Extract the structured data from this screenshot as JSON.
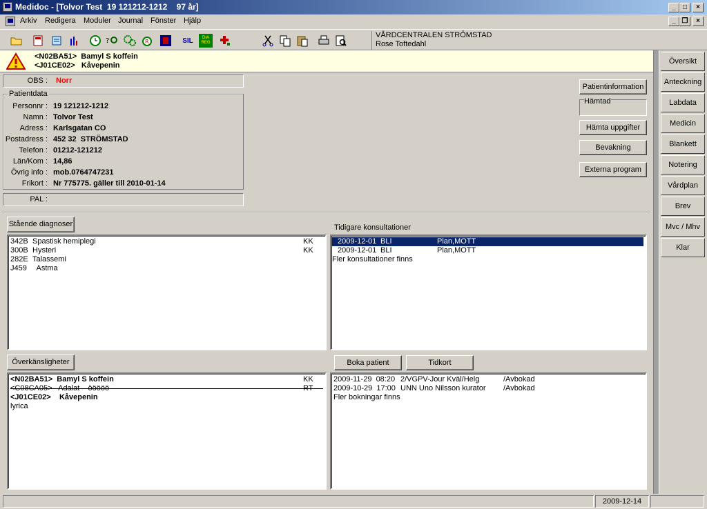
{
  "window": {
    "title": "Medidoc - [Tolvor Test  19 121212-1212    97 år]",
    "controls": {
      "minimize": "_",
      "maximize": "□",
      "close": "×",
      "restore": "❐"
    }
  },
  "menu": [
    {
      "label": "Arkiv"
    },
    {
      "label": "Redigera"
    },
    {
      "label": "Moduler"
    },
    {
      "label": "Journal"
    },
    {
      "label": "Fönster"
    },
    {
      "label": "Hjälp"
    }
  ],
  "toolbar": {
    "icons": [
      "open-folder-icon",
      "patient-card-icon",
      "notes-icon",
      "chart-icon",
      "clock-icon",
      "search-patient-icon",
      "gears-icon",
      "prescription-icon",
      "image-icon",
      "sil-icon",
      "diareg-icon",
      "medical-cross-icon",
      "scissors-icon",
      "copy-icon",
      "paste-icon",
      "print-icon",
      "print-preview-icon"
    ],
    "sil_text": "SIL",
    "diareg_text": "DIA\nREG",
    "clinic_name": "VÅRDCENTRALEN STRÖMSTAD",
    "user_name": "Rose Toftedahl"
  },
  "warning": {
    "line1": "<N02BA51>  Bamyl S koffein",
    "line2": "<J01CE02>   Kåvepenin"
  },
  "obs": {
    "label": "OBS :",
    "value": "Norr",
    "color": "#ff0000"
  },
  "patientdata": {
    "title": "Patientdata",
    "fields": [
      {
        "label": "Personnr :",
        "value": "19 121212-1212"
      },
      {
        "label": "Namn :",
        "value": "Tolvor Test"
      },
      {
        "label": "Adress :",
        "value": "Karlsgatan CO"
      },
      {
        "label": "Postadress :",
        "value": "452 32  STRÖMSTAD"
      },
      {
        "label": "Telefon :",
        "value": "01212-121212"
      },
      {
        "label": "Län/Kom :",
        "value": "14,86"
      },
      {
        "label": "Övrig info :",
        "value": "mob.0764747231"
      },
      {
        "label": "Frikort :",
        "value": "Nr 775775. gäller till 2010-01-14"
      }
    ]
  },
  "pal": {
    "label": "PAL :",
    "value": ""
  },
  "right_buttons": {
    "patientinformation": "Patientinformation",
    "hamtad": "Hämtad",
    "hamta": "Hämta uppgifter",
    "bevakning": "Bevakning",
    "externa": "Externa program"
  },
  "diagnoses": {
    "button": "Stående diagnoser",
    "rows": [
      {
        "code": "342B",
        "text": "Spastisk hemiplegi",
        "flag": "KK"
      },
      {
        "code": "300B",
        "text": "Hysteri",
        "flag": "KK"
      },
      {
        "code": "282E",
        "text": "Talassemi",
        "flag": ""
      },
      {
        "code": "J459",
        "text": "  Astma",
        "flag": ""
      }
    ]
  },
  "consultations": {
    "label": "Tidigare konsultationer",
    "rows": [
      {
        "date": "2009-12-01",
        "unit": "BLI",
        "type": "Plan,MOTT",
        "selected": true
      },
      {
        "date": "2009-12-01",
        "unit": "BLI",
        "type": "Plan,MOTT",
        "selected": false
      }
    ],
    "more": "Fler konsultationer finns"
  },
  "allergies": {
    "button": "Överkänsligheter",
    "rows": [
      {
        "text": "<N02BA51>  Bamyl S koffein",
        "flag": "KK",
        "bold": true,
        "strike": false
      },
      {
        "text": "<C08CA05>   Adalat    ööööö",
        "flag": "RT",
        "bold": false,
        "strike": true
      },
      {
        "text": "<J01CE02>    Kåvepenin",
        "flag": "",
        "bold": true,
        "strike": false
      },
      {
        "text": "lyrica",
        "flag": "",
        "bold": false,
        "strike": false
      }
    ]
  },
  "bookings": {
    "boka": "Boka  patient",
    "tidkort": "Tidkort",
    "rows": [
      {
        "datetime": "2009-11-29  08:20",
        "desc": "2/VGPV-Jour Kväl/Helg",
        "status": "/Avbokad"
      },
      {
        "datetime": "2009-10-29  17:00",
        "desc": "UNN Uno Nilsson kurator",
        "status": "/Avbokad"
      }
    ],
    "more": "Fler bokningar finns"
  },
  "sidetabs": [
    {
      "label": "Översikt",
      "active": true
    },
    {
      "label": "Anteckning",
      "active": false
    },
    {
      "label": "Labdata",
      "active": false
    },
    {
      "label": "Medicin",
      "active": false
    },
    {
      "label": "Blankett",
      "active": false
    },
    {
      "label": "Notering",
      "active": false
    },
    {
      "label": "Vårdplan",
      "active": false
    },
    {
      "label": "Brev",
      "active": false
    },
    {
      "label": "Mvc / Mhv",
      "active": false
    },
    {
      "label": "Klar",
      "active": false
    }
  ],
  "status": {
    "date": "2009-12-14"
  }
}
